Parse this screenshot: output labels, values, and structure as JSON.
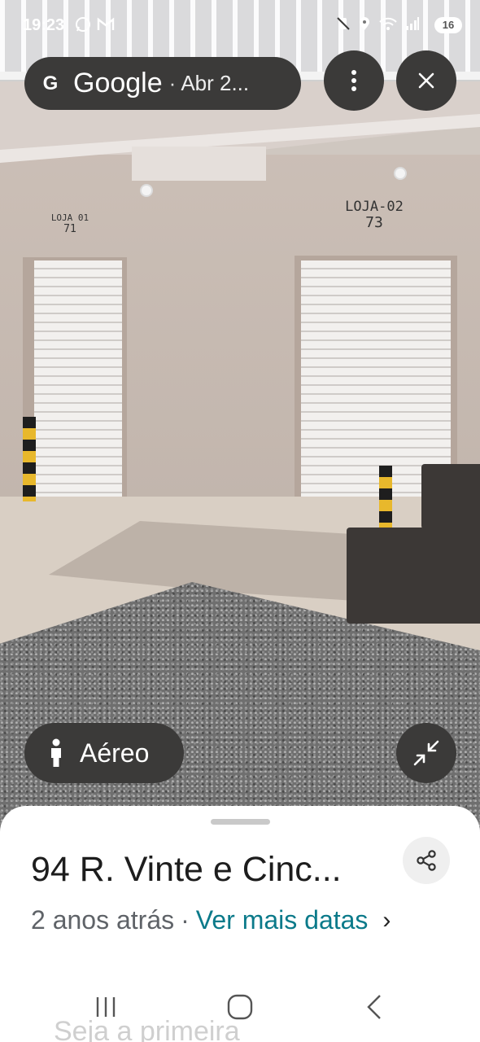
{
  "status_bar": {
    "time": "19:23",
    "left_icons": [
      "whatsapp-icon",
      "gmail-icon"
    ],
    "right_icons": [
      "mute-vibrate-icon",
      "location-icon",
      "wifi-icon",
      "signal-icon"
    ],
    "battery": "16"
  },
  "top_bar": {
    "brand": "Google",
    "separator": "·",
    "date": "Abr 2...",
    "more_icon": "more-vert-icon",
    "close_icon": "close-icon"
  },
  "scene": {
    "shop1_label": "LOJA 01",
    "shop1_number": "71",
    "shop2_label": "LOJA-02",
    "shop2_number": "73"
  },
  "aerial_button": {
    "icon": "person-icon",
    "label": "Aéreo"
  },
  "collapse_button": {
    "icon": "collapse-arrows-icon"
  },
  "sheet": {
    "address": "94 R. Vinte e Cinc...",
    "age": "2 anos atrás",
    "separator": "·",
    "more_dates": "Ver mais datas",
    "chevron": "›",
    "faded_text": "Seja a primeira",
    "share_icon": "share-icon"
  },
  "nav": {
    "recents": "recents-icon",
    "home": "home-icon",
    "back": "back-icon"
  },
  "colors": {
    "pill_bg": "#3b3a39",
    "link": "#0b7a8a",
    "sheet_bg": "#ffffff"
  }
}
